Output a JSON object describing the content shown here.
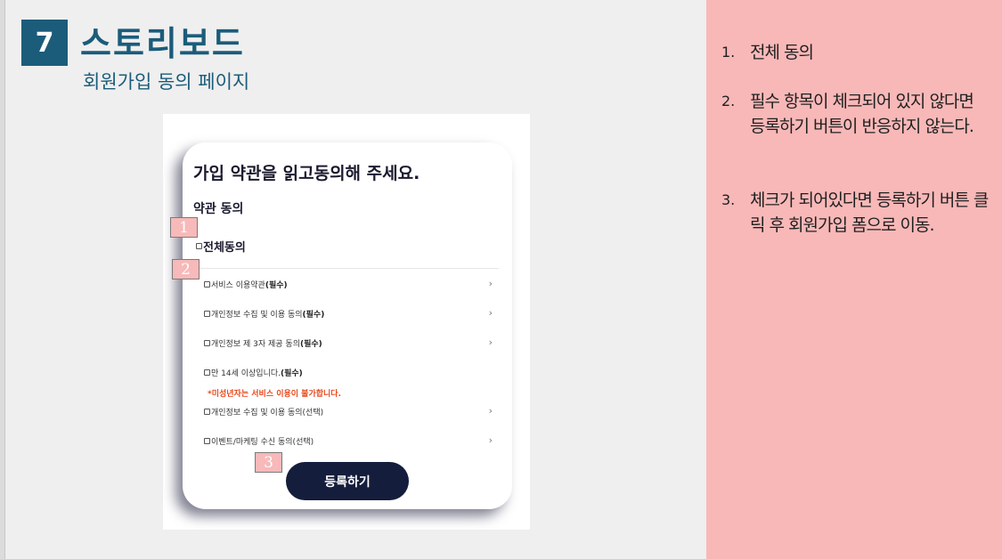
{
  "slide": {
    "number": "7",
    "title": "스토리보드",
    "subtitle": "회원가입 동의 페이지"
  },
  "screen": {
    "heading": "가입 약관을 읽고동의해 주세요.",
    "section_title": "약관 동의",
    "all_agree": "전체동의",
    "items": [
      {
        "label": "서비스 이용약관",
        "suffix": "(필수)",
        "chevron": true
      },
      {
        "label": "개인정보 수집 및 이용 동의",
        "suffix": "(필수)",
        "chevron": true
      },
      {
        "label": "개인정보 제 3자 제공 동의",
        "suffix": "(필수)",
        "chevron": true
      },
      {
        "label": "만 14세 이상입니다.",
        "suffix": "(필수)",
        "chevron": false
      },
      {
        "label": "개인정보 수집 및 이용 동의(선택)",
        "suffix": "",
        "chevron": true
      },
      {
        "label": "이벤트/마케팅 수신 동의(선택)",
        "suffix": "",
        "chevron": true
      }
    ],
    "warning": "*미성년자는 서비스 이용이 불가합니다.",
    "register_button": "등록하기",
    "chevron_glyph": "›"
  },
  "markers": [
    "1",
    "2",
    "3"
  ],
  "notes": [
    {
      "num": "1.",
      "text": "전체 동의"
    },
    {
      "num": "2.",
      "text": "필수 항목이 체크되어 있지 않다면 등록하기 버튼이 반응하지 않는다."
    },
    {
      "num": "3.",
      "text": "체크가 되어있다면 등록하기 버튼 클릭 후 회원가입 폼으로 이동."
    }
  ],
  "colors": {
    "title": "#1b5c7a",
    "right_panel": "#f8b8b8",
    "marker": "#f7b9b9",
    "button": "#141d3b",
    "warning": "#e8491d"
  }
}
